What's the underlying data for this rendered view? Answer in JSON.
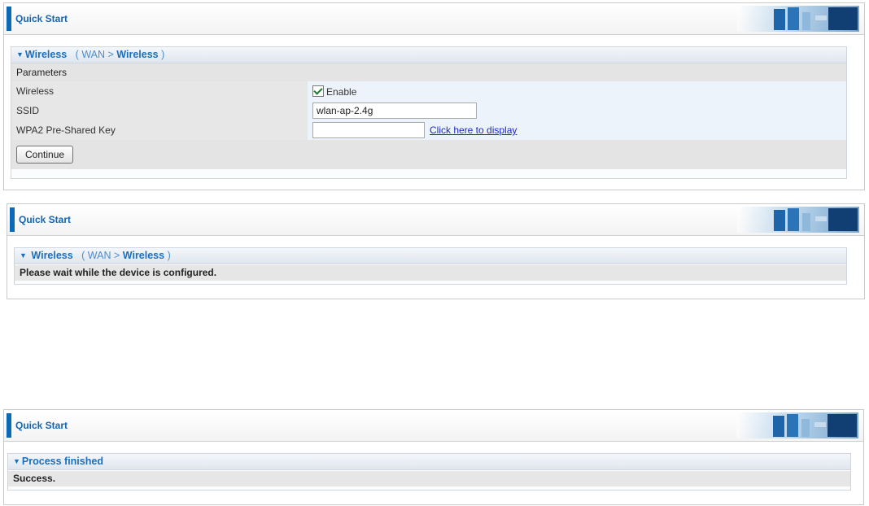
{
  "panel1": {
    "title": "Quick Start",
    "section": {
      "label": "Wireless",
      "crumb_open": "(",
      "crumb_parent": "WAN",
      "crumb_sep": ">",
      "crumb_current": "Wireless",
      "crumb_close": ")"
    },
    "group_label": "Parameters",
    "rows": {
      "wireless_label": "Wireless",
      "wireless_value": "Enable",
      "ssid_label": "SSID",
      "ssid_value": "wlan-ap-2.4g",
      "psk_label": "WPA2 Pre-Shared Key",
      "psk_value": "",
      "psk_link": "Click here to display"
    },
    "continue_label": "Continue"
  },
  "panel2": {
    "title": "Quick Start",
    "section": {
      "label": "Wireless",
      "crumb_open": "(",
      "crumb_parent": "WAN",
      "crumb_sep": ">",
      "crumb_current": "Wireless",
      "crumb_close": ")"
    },
    "message": "Please wait while the device is configured."
  },
  "panel3": {
    "title": "Quick Start",
    "section_label": "Process finished",
    "message": "Success."
  },
  "colors": {
    "accent": "#0a6ab8",
    "header_text": "#1a6fbd",
    "link": "#1b27c9"
  }
}
